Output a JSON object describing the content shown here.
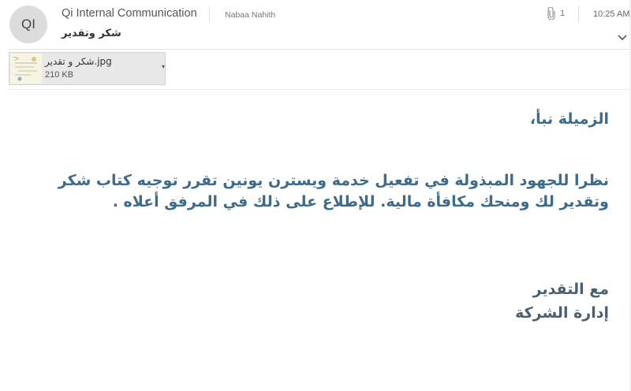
{
  "header": {
    "avatar_initials": "QI",
    "sender": "Qi Internal Communication",
    "recipient": "Nabaa Nahith",
    "subject": "شكر وتقدير",
    "attachment_count": "1",
    "time": "10:25 AM"
  },
  "attachment": {
    "file_name": "شكر و تقدير.jpg",
    "file_size": "210 KB",
    "icon": "paperclip-icon"
  },
  "body": {
    "greeting": "الزميلة نبأ،",
    "paragraph": "نظرا للجهود المبذولة في تفعيل خدمة ويسترن يونين تقرر توجيه كتاب شكر وتقدير لك ومنحك مكافأة مالية. للإطلاع على ذلك في المرفق أعلاه .",
    "closing": "مع التقدير",
    "company": "إدارة الشركة"
  },
  "colors": {
    "body_text": "#3d6b8c",
    "avatar_bg": "#dcdcdc"
  }
}
